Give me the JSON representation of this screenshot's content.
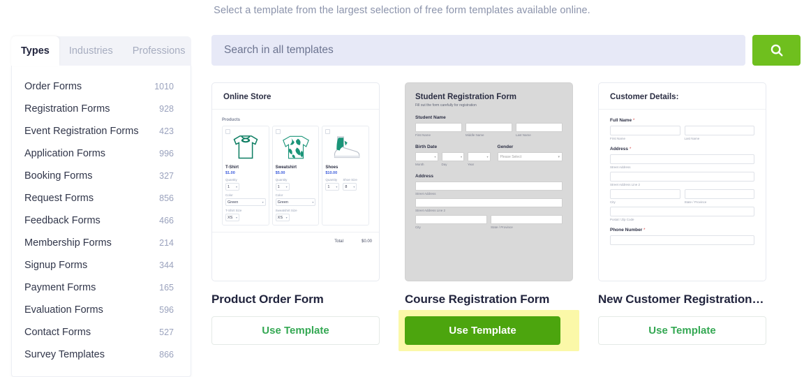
{
  "tagline": "Select a template from the largest selection of free form templates available online.",
  "tabs": [
    {
      "label": "Types",
      "active": true
    },
    {
      "label": "Industries",
      "active": false
    },
    {
      "label": "Professions",
      "active": false
    }
  ],
  "categories": [
    {
      "label": "Order Forms",
      "count": "1010"
    },
    {
      "label": "Registration Forms",
      "count": "928"
    },
    {
      "label": "Event Registration Forms",
      "count": "423"
    },
    {
      "label": "Application Forms",
      "count": "996"
    },
    {
      "label": "Booking Forms",
      "count": "327"
    },
    {
      "label": "Request Forms",
      "count": "856"
    },
    {
      "label": "Feedback Forms",
      "count": "466"
    },
    {
      "label": "Membership Forms",
      "count": "214"
    },
    {
      "label": "Signup Forms",
      "count": "344"
    },
    {
      "label": "Payment Forms",
      "count": "165"
    },
    {
      "label": "Evaluation Forms",
      "count": "596"
    },
    {
      "label": "Contact Forms",
      "count": "527"
    },
    {
      "label": "Survey Templates",
      "count": "866"
    }
  ],
  "search": {
    "placeholder": "Search in all templates",
    "value": "",
    "icon": "search-icon"
  },
  "templates": [
    {
      "title": "Product Order Form",
      "button_label": "Use Template",
      "highlighted": false
    },
    {
      "title": "Course Registration Form",
      "button_label": "Use Template",
      "highlighted": true
    },
    {
      "title": "New Customer Registration F...",
      "button_label": "Use Template",
      "highlighted": false
    }
  ],
  "preview_store": {
    "header": "Online Store",
    "products_label": "Products",
    "products": [
      {
        "name": "T-Shirt",
        "price": "$1.00",
        "quantity_label": "Quantity",
        "quantity_value": "1",
        "color_label": "Color",
        "color_value": "Green",
        "size_label": "T-Shirt Size",
        "size_value": "XS"
      },
      {
        "name": "Sweatshirt",
        "price": "$5.00",
        "quantity_label": "Quantity",
        "quantity_value": "1",
        "color_label": "Color",
        "color_value": "Green",
        "size_label": "Sweatshirt Size",
        "size_value": "XS"
      },
      {
        "name": "Shoes",
        "price": "$10.00",
        "quantity_label": "Quantity",
        "quantity_value": "1",
        "shoe_size_label": "Shoe Size",
        "shoe_size_value": "8"
      }
    ],
    "total_label": "Total",
    "total_value": "$0.00"
  },
  "preview_student": {
    "title": "Student Registration Form",
    "subtitle": "Fill out the form carefully for registration",
    "student_name_label": "Student Name",
    "first_name_label": "First Name",
    "middle_name_label": "Middle Name",
    "last_name_label": "Last Name",
    "birth_date_label": "Birth Date",
    "month_label": "Month",
    "day_label": "Day",
    "year_label": "Year",
    "gender_label": "Gender",
    "gender_placeholder": "Please Select",
    "address_label": "Address",
    "street_address_label": "Street Address",
    "street_address_2_label": "Street Address Line 2",
    "city_label": "City",
    "state_label": "State / Province"
  },
  "preview_customer": {
    "header": "Customer Details:",
    "full_name_label": "Full Name",
    "first_name_label": "First Name",
    "last_name_label": "Last Name",
    "address_label": "Address",
    "street_address_label": "Street Address",
    "street_address_2_label": "Street Address Line 2",
    "city_label": "City",
    "state_label": "State / Province",
    "postal_label": "Postal / Zip Code",
    "phone_label": "Phone Number",
    "required_mark": "*"
  },
  "colors": {
    "accent_green": "#6fbf1e",
    "primary_green": "#4ca50e",
    "link_green": "#34a853",
    "highlight_yellow": "#fbf8a8",
    "search_bg": "#e7e9f7",
    "tagline": "#8b93ab"
  }
}
